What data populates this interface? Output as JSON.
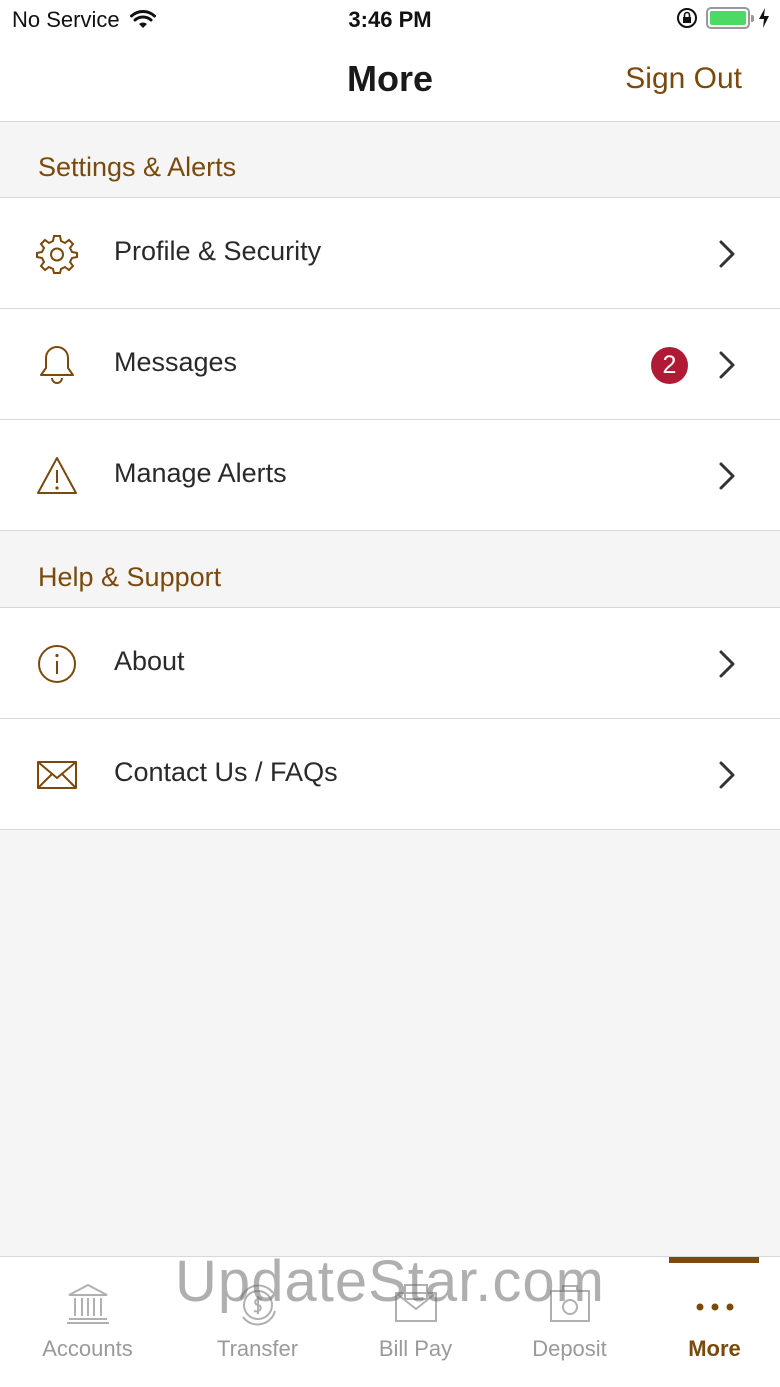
{
  "status": {
    "carrier": "No Service",
    "time": "3:46 PM"
  },
  "nav": {
    "title": "More",
    "sign_out": "Sign Out"
  },
  "sections": {
    "settings": {
      "title": "Settings & Alerts"
    },
    "help": {
      "title": "Help & Support"
    }
  },
  "items": {
    "profile": {
      "label": "Profile & Security",
      "icon": "gear-icon"
    },
    "messages": {
      "label": "Messages",
      "icon": "bell-icon",
      "badge": "2"
    },
    "alerts": {
      "label": "Manage Alerts",
      "icon": "warning-icon"
    },
    "about": {
      "label": "About",
      "icon": "info-icon"
    },
    "contact": {
      "label": "Contact Us / FAQs",
      "icon": "envelope-icon"
    }
  },
  "tabs": {
    "accounts": "Accounts",
    "transfer": "Transfer",
    "billpay": "Bill Pay",
    "deposit": "Deposit",
    "more": "More"
  },
  "watermark": "UpdateStar.com",
  "colors": {
    "accent": "#7a4a0c",
    "badge": "#b01a35",
    "battery": "#4cd964"
  }
}
